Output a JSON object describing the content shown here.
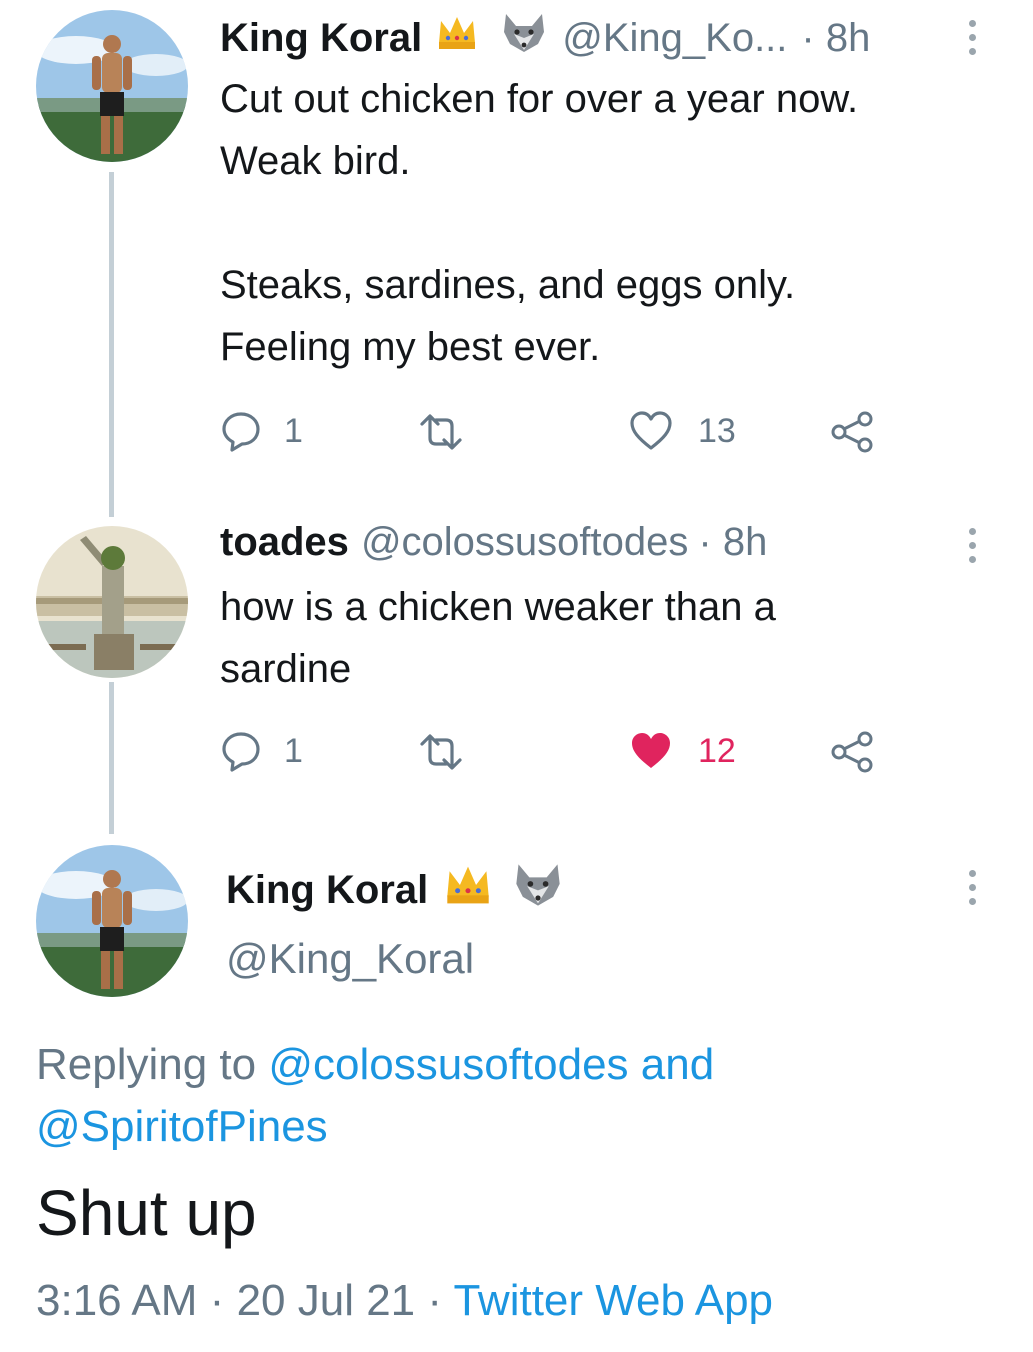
{
  "tweet1": {
    "name": "King Koral",
    "badges": [
      "crown-icon",
      "wolf-icon"
    ],
    "handle": "@King_Ko...",
    "time": "· 8h",
    "line1": "Cut out chicken for over a year now.",
    "line2": "Weak bird.",
    "line3": "Steaks, sardines, and eggs only.",
    "line4": "Feeling my best ever.",
    "replies": "1",
    "likes": "13"
  },
  "tweet2": {
    "name": "toades",
    "handle": "@colossusoftodes",
    "time": "· 8h",
    "line1": "how is a chicken weaker than a",
    "line2": "sardine",
    "replies": "1",
    "likes": "12",
    "liked_color": "#e0245e"
  },
  "tweet3": {
    "name": "King Koral",
    "badges": [
      "crown-icon",
      "wolf-icon"
    ],
    "handle": "@King_Koral",
    "replying_prefix": "Replying to",
    "replying_user1": "@colossusoftodes",
    "replying_and": "and",
    "replying_user2": "@SpiritofPines",
    "text": "Shut up",
    "time": "3:16 AM",
    "sep1": "·",
    "date": "20 Jul 21",
    "sep2": "·",
    "source": "Twitter Web App"
  },
  "colors": {
    "link": "#1b95e0",
    "muted": "#657786",
    "thread_line": "#c4cfd6"
  }
}
